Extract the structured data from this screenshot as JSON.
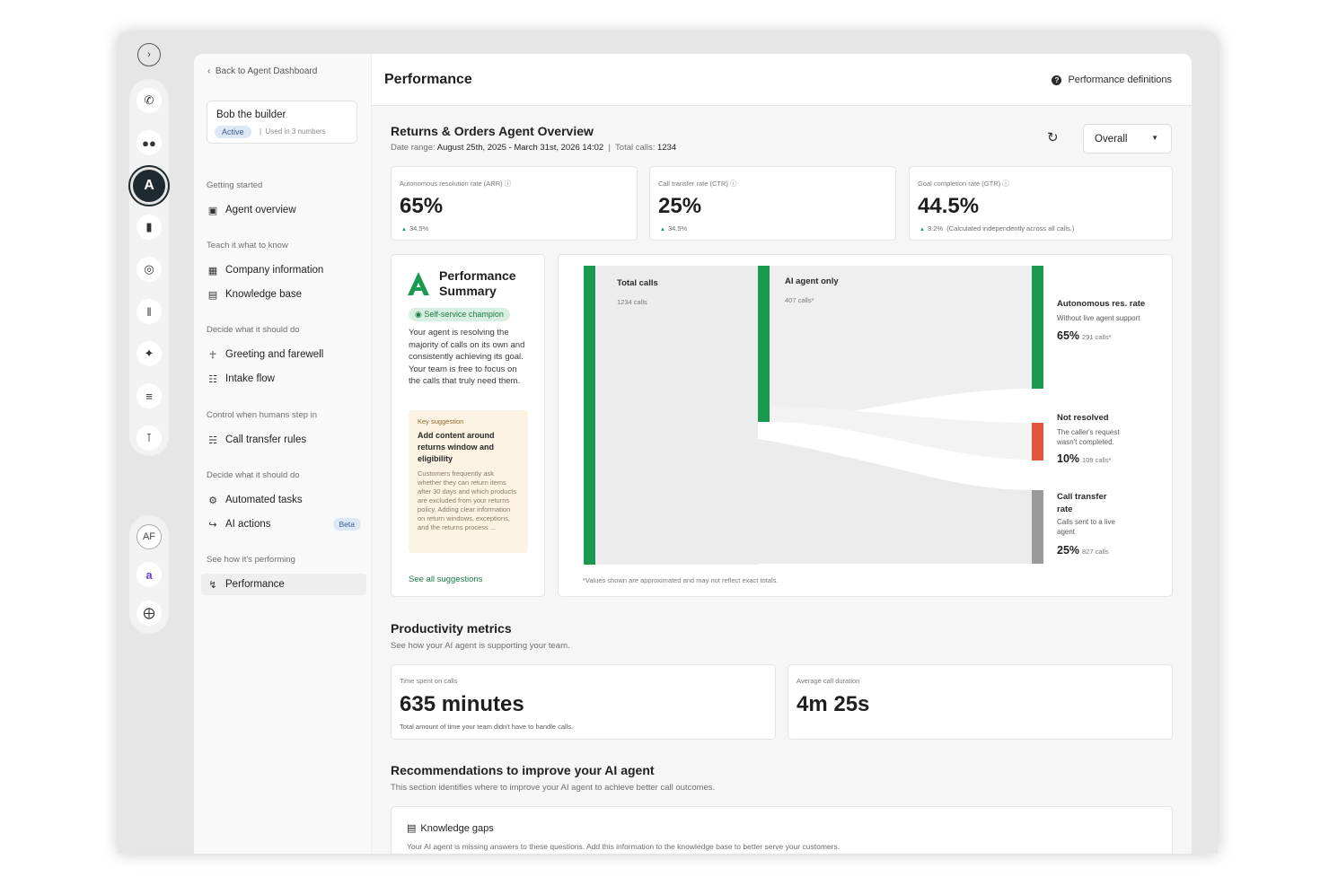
{
  "rail": {
    "expand_icon": "chevron-right-icon",
    "icons": [
      "phone-icon",
      "users-icon",
      "agent-logo-icon",
      "bar-chart-icon",
      "target-icon",
      "audio-wave-icon",
      "sparkle-icon",
      "sliders-icon",
      "branch-icon"
    ],
    "avatar_initials": "AF"
  },
  "side": {
    "back_label": "Back to Agent Dashboard",
    "agent": {
      "name": "Bob the builder",
      "status": "Active",
      "used": "Used in 3 numbers"
    },
    "sections": [
      {
        "title": "Getting started",
        "items": [
          {
            "label": "Agent overview",
            "icon": "robot-icon"
          }
        ]
      },
      {
        "title": "Teach it what to know",
        "items": [
          {
            "label": "Company information",
            "icon": "building-icon"
          },
          {
            "label": "Knowledge base",
            "icon": "book-icon"
          }
        ]
      },
      {
        "title": "Decide what it should do",
        "items": [
          {
            "label": "Greeting and farewell",
            "icon": "handshake-icon"
          },
          {
            "label": "Intake flow",
            "icon": "clipboard-icon"
          }
        ]
      },
      {
        "title": "Control when humans step in",
        "items": [
          {
            "label": "Call transfer rules",
            "icon": "hierarchy-icon"
          }
        ]
      },
      {
        "title": "Decide what it should do",
        "items": [
          {
            "label": "Automated tasks",
            "icon": "gear-icon"
          },
          {
            "label": "AI actions",
            "icon": "flow-icon",
            "badge": "Beta"
          }
        ]
      },
      {
        "title": "See how it's performing",
        "items": [
          {
            "label": "Performance",
            "icon": "line-chart-icon"
          }
        ]
      }
    ]
  },
  "header": {
    "title": "Performance",
    "definitions_label": "Performance definitions"
  },
  "overview": {
    "title": "Returns & Orders Agent Overview",
    "date_prefix": "Date range:",
    "date_range": "August 25th, 2025 - March 31st, 2026 14:02",
    "calls_prefix": "Total calls:",
    "total_calls": "1234",
    "select_value": "Overall",
    "kpis": [
      {
        "label": "Autonomous resolution rate (ARR)",
        "value": "65%",
        "delta": "34.5%"
      },
      {
        "label": "Call transfer rate (CTR)",
        "value": "25%",
        "delta": "34.5%"
      },
      {
        "label": "Goal completion rate (GTR)",
        "value": "44.5%",
        "delta": "3.2%",
        "note": "(Calculated independently across all calls.)"
      }
    ]
  },
  "summary": {
    "title": "Performance Summary",
    "badge": "Self-service champion",
    "text": "Your agent is resolving the majority of calls on its own and consistently achieving its goal. Your team is free to focus on the calls that truly need them.",
    "suggestion_kicker": "Key suggestion",
    "suggestion_title": "Add content around returns window and eligibility",
    "suggestion_text": "Customers frequently ask whether they can return items after 30 days and which products are excluded from your returns policy. Adding clear information on return windows, exceptions, and the returns process ...",
    "link": "See all suggestions"
  },
  "sankey": {
    "colors": {
      "green": "#1a9a4e",
      "red": "#e2553a",
      "gray": "#9a9a9a"
    },
    "total": {
      "label": "Total calls",
      "sub": "1234 calls"
    },
    "ai": {
      "label": "AI agent only",
      "sub": "407 calls*"
    },
    "outcomes": [
      {
        "label": "Autonomous res. rate",
        "desc": "Without live agent support",
        "value": "65%",
        "calls": "291 calls*"
      },
      {
        "label": "Not resolved",
        "desc": "The caller's request wasn't completed.",
        "value": "10%",
        "calls": "109 calls*"
      },
      {
        "label": "Call transfer rate",
        "desc": "Calls sent to a live agent",
        "value": "25%",
        "calls": "827 calls"
      }
    ],
    "footnote": "*Values shown are approximated and may not reflect exact totals."
  },
  "productivity": {
    "title": "Productivity metrics",
    "subtitle": "See how your AI agent is supporting your team.",
    "cards": [
      {
        "label": "Time spent on calls",
        "value": "635 minutes",
        "desc": "Total amount of time your team didn't have to handle calls."
      },
      {
        "label": "Average call duration",
        "value": "4m 25s",
        "desc": ""
      }
    ]
  },
  "recommendations": {
    "title": "Recommendations to improve your AI agent",
    "subtitle": "This section identifies where to improve your AI agent to achieve better call outcomes.",
    "gaps_title": "Knowledge gaps",
    "gaps_desc": "Your AI agent is missing answers to these questions. Add this information to the knowledge base to better serve your customers."
  }
}
